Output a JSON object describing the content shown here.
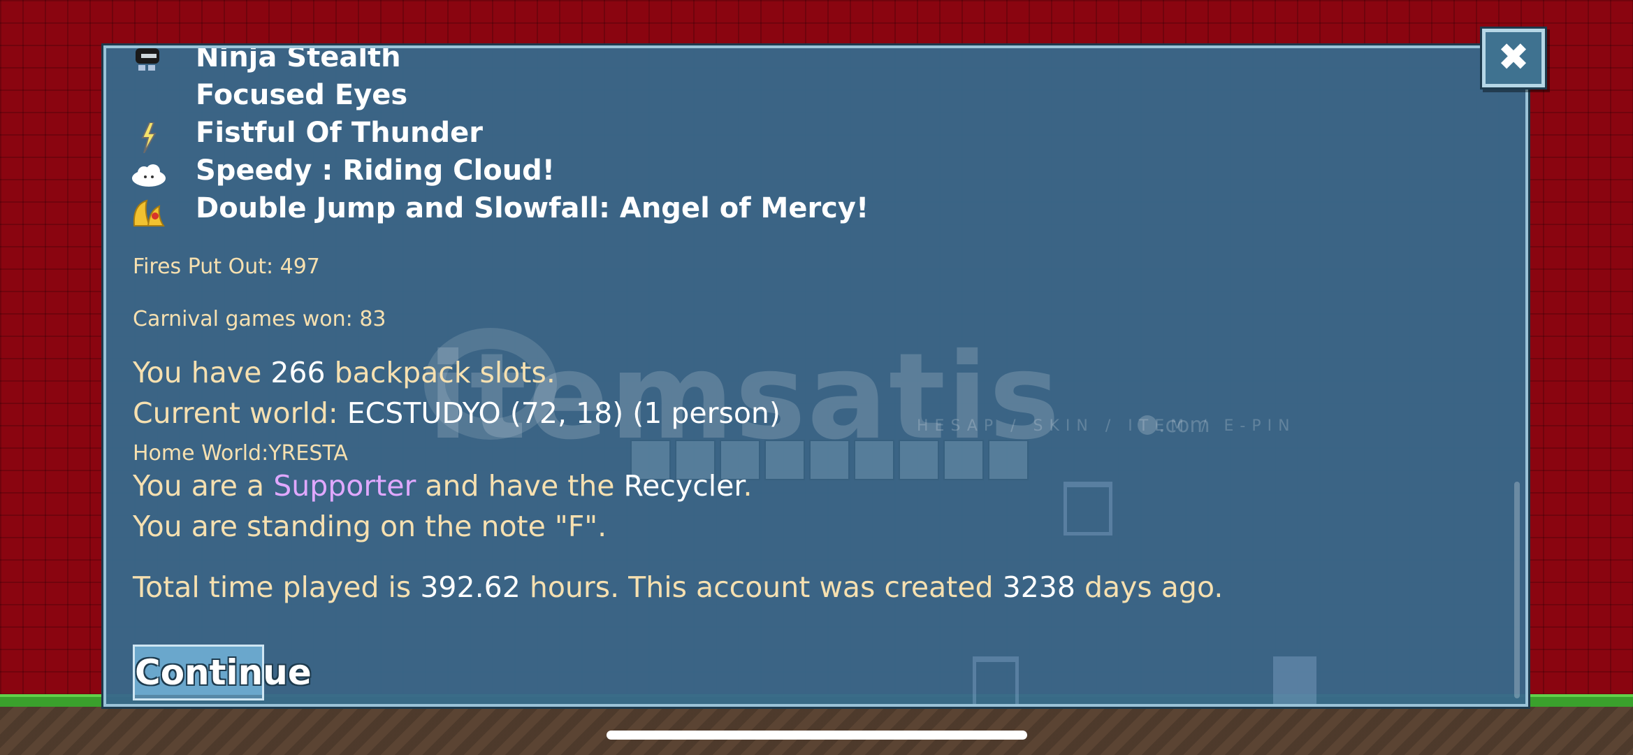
{
  "perks": [
    {
      "icon": "ninja-mask-icon",
      "label": "Ninja Stealth"
    },
    {
      "icon": "",
      "label": "Focused Eyes"
    },
    {
      "icon": "lightning-bolt-icon",
      "label": "Fistful Of Thunder"
    },
    {
      "icon": "cloud-icon",
      "label": "Speedy : Riding Cloud!"
    },
    {
      "icon": "angel-wings-icon",
      "label": "Double Jump and Slowfall: Angel of Mercy!"
    }
  ],
  "stats": {
    "fires": "Fires Put Out: 497",
    "carnival": "Carnival games won: 83",
    "backpack_pre": "You have ",
    "backpack_num": "266",
    "backpack_post": " backpack slots.",
    "world_pre": "Current world: ",
    "world_val": "ECSTUDYO (72, 18) (1 person)",
    "home": "Home World:YRESTA",
    "role_pre": "You are a ",
    "role": "Supporter",
    "role_mid": " and have the ",
    "role_item": "Recycler",
    "role_end": ".",
    "note": "You are standing on the note \"F\".",
    "time_pre": "Total time played is ",
    "time_val": "392.62",
    "time_mid": " hours.  This account was created ",
    "days_val": "3238",
    "days_post": " days ago."
  },
  "continue_label": "Continue",
  "close_label": "✖",
  "watermark": {
    "main": "itemsatis",
    "sub": "HESAP / SKIN / ITEM / E-PIN",
    "com": ".com"
  },
  "colors": {
    "panel": "#38688a",
    "text": "#f6e0b0",
    "highlight": "#ffffff",
    "supporter": "#e0a8ff",
    "background": "#8a0510"
  }
}
